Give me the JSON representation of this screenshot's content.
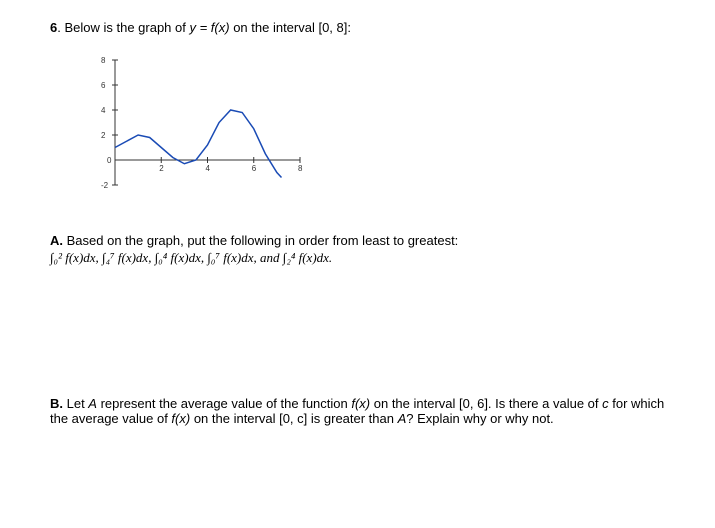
{
  "problem": {
    "number": "6",
    "prompt_prefix": ". Below is the graph of ",
    "prompt_equation": "y = f(x)",
    "prompt_suffix": " on the interval [0, 8]:"
  },
  "chart_data": {
    "type": "line",
    "x_range": [
      0,
      8
    ],
    "y_range": [
      -2,
      8
    ],
    "x_ticks": [
      2,
      4,
      6,
      8
    ],
    "y_ticks": [
      -2,
      0,
      2,
      4,
      6,
      8
    ],
    "series": [
      {
        "name": "f(x)",
        "points": [
          [
            0,
            1.0
          ],
          [
            0.5,
            1.5
          ],
          [
            1.0,
            2.0
          ],
          [
            1.5,
            1.8
          ],
          [
            2.0,
            1.0
          ],
          [
            2.5,
            0.2
          ],
          [
            3.0,
            -0.3
          ],
          [
            3.5,
            0.0
          ],
          [
            4.0,
            1.2
          ],
          [
            4.5,
            3.0
          ],
          [
            5.0,
            4.0
          ],
          [
            5.5,
            3.8
          ],
          [
            6.0,
            2.5
          ],
          [
            6.5,
            0.5
          ],
          [
            7.0,
            -1.0
          ],
          [
            7.2,
            -1.4
          ]
        ]
      }
    ]
  },
  "partA": {
    "label": "A.",
    "text": " Based on the graph, put the following in order from least to greatest:",
    "integrals": "∫₀² f(x)dx,  ∫₄⁷ f(x)dx,  ∫₀⁴ f(x)dx,  ∫₀⁷ f(x)dx,  and  ∫₂⁴ f(x)dx."
  },
  "partB": {
    "label": "B.",
    "text_before": " Let ",
    "var_A": "A",
    "text_mid1": " represent the average value of the function ",
    "fx1": "f(x)",
    "text_mid2": " on the interval [0, 6]. Is there a value of ",
    "var_c": "c",
    "text_mid3": " for which the average value of ",
    "fx2": "f(x)",
    "text_mid4": " on the interval [0, c] is greater than ",
    "var_A2": "A",
    "text_end": "? Explain why or why not."
  }
}
